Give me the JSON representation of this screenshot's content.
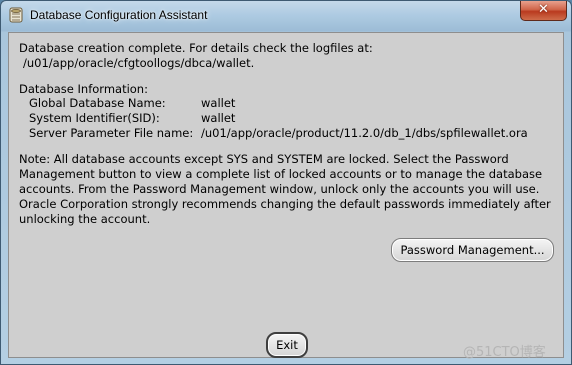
{
  "window": {
    "title": "Database Configuration Assistant",
    "close_label": "✕"
  },
  "message": {
    "completion_line1": "Database creation complete. For details check the logfiles at:",
    "completion_line2": "/u01/app/oracle/cfgtoollogs/dbca/wallet.",
    "info_heading": "Database Information:",
    "info_rows": [
      {
        "label": "Global Database Name:",
        "value": "wallet"
      },
      {
        "label": "System Identifier(SID):",
        "value": "wallet"
      },
      {
        "label": "Server Parameter File name:",
        "value": "/u01/app/oracle/product/11.2.0/db_1/dbs/spfilewallet.ora"
      }
    ],
    "note_lines": [
      "Note: All database accounts except SYS and SYSTEM are locked. Select the Password",
      "Management button to view a complete list of locked accounts or to manage the database",
      "accounts. From the Password Management window, unlock only the accounts you will use.",
      "Oracle Corporation strongly recommends changing the default passwords immediately after",
      "unlocking the account."
    ]
  },
  "buttons": {
    "password_management": "Password Management...",
    "exit": "Exit"
  },
  "watermark": "@51CTO博客"
}
